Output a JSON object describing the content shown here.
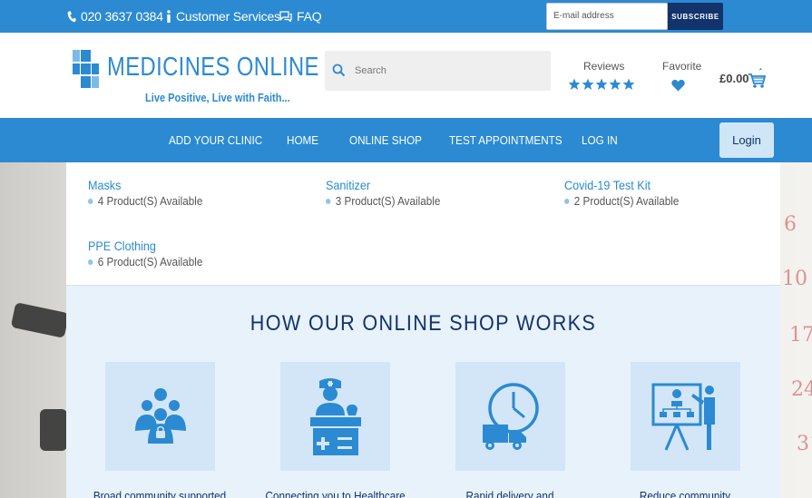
{
  "topbar": {
    "phone": "020 3637 0384",
    "customer_services": "Customer Services",
    "faq": "FAQ",
    "email_placeholder": "E-mail address",
    "subscribe": "SUBSCRIBE"
  },
  "header": {
    "logo_text": "MEDICINES ONLINE",
    "tagline": "Live Positive, Live with Faith...",
    "search_placeholder": "Search",
    "reviews_label": "Reviews",
    "favorite_label": "Favorite",
    "cart_total": "£0.00"
  },
  "nav": {
    "items": [
      "ADD YOUR CLINIC",
      "HOME",
      "ONLINE SHOP",
      "TEST APPOINTMENTS",
      "LOG IN"
    ],
    "login": "Login"
  },
  "categories": [
    {
      "name": "Masks",
      "count": "4 Product(S) Available"
    },
    {
      "name": "Sanitizer",
      "count": "3 Product(S) Available"
    },
    {
      "name": "Covid-19 Test Kit",
      "count": "2 Product(S) Available"
    },
    {
      "name": "PPE Clothing",
      "count": "6 Product(S) Available"
    }
  ],
  "works": {
    "title": "HOW OUR ONLINE SHOP WORKS",
    "cards": [
      {
        "icon": "community-icon",
        "text": "Broad community supported"
      },
      {
        "icon": "healthcare-desk-icon",
        "text": "Connecting you to Healthcare"
      },
      {
        "icon": "delivery-clock-icon",
        "text": "Rapid delivery and"
      },
      {
        "icon": "presentation-icon",
        "text": "Reduce community"
      }
    ]
  },
  "colors": {
    "primary": "#2b8ad2",
    "dark_navy": "#12336b",
    "light_panel": "#e8f2fb"
  }
}
